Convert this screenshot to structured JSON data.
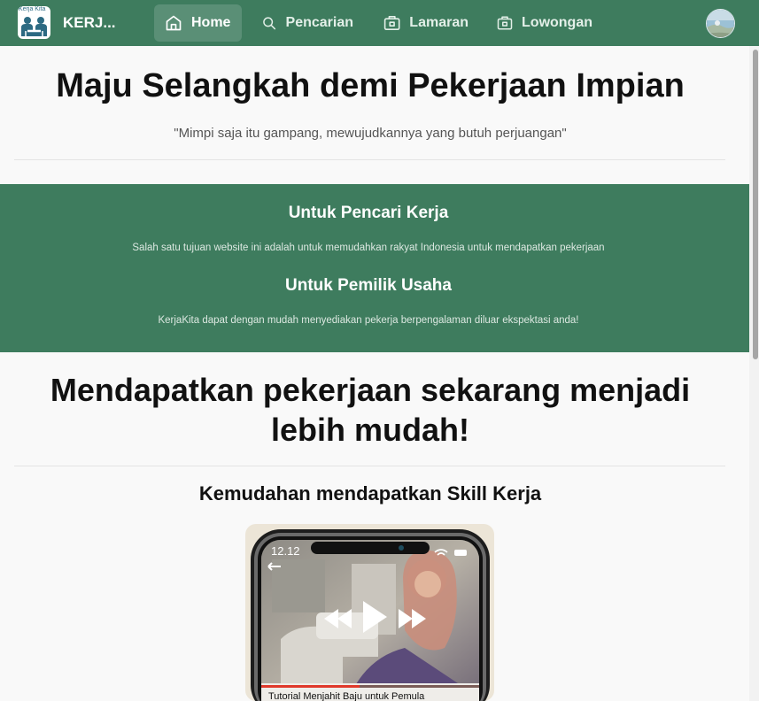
{
  "navbar": {
    "logo_text": "Kerja Kita",
    "brand": "KERJ...",
    "items": [
      {
        "label": "Home",
        "icon": "home-icon",
        "active": true
      },
      {
        "label": "Pencarian",
        "icon": "search-icon",
        "active": false
      },
      {
        "label": "Lamaran",
        "icon": "briefcase-icon",
        "active": false
      },
      {
        "label": "Lowongan",
        "icon": "briefcase-icon",
        "active": false
      }
    ],
    "avatar_icon": "user-avatar"
  },
  "hero": {
    "title": "Maju Selangkah demi Pekerjaan Impian",
    "quote": "\"Mimpi saja itu gampang, mewujudkannya yang butuh perjuangan\""
  },
  "features": [
    {
      "title": "Untuk Pencari Kerja",
      "text": "Salah satu tujuan website ini adalah untuk memudahkan rakyat Indonesia untuk mendapatkan pekerjaan"
    },
    {
      "title": "Untuk Pemilik Usaha",
      "text": "KerjaKita dapat dengan mudah menyediakan pekerja berpengalaman diluar ekspektasi anda!"
    }
  ],
  "section": {
    "headline_line1": "Mendapatkan pekerjaan sekarang menjadi",
    "headline_line2": "lebih mudah!",
    "subtitle": "Kemudahan mendapatkan Skill Kerja"
  },
  "phone": {
    "time": "12.12",
    "video_caption": "Tutorial Menjahit Baju untuk Pemula",
    "progress": 0.45
  },
  "colors": {
    "primary": "#3e7c5e",
    "background": "#f9f9f9",
    "progress": "#e0392b"
  }
}
